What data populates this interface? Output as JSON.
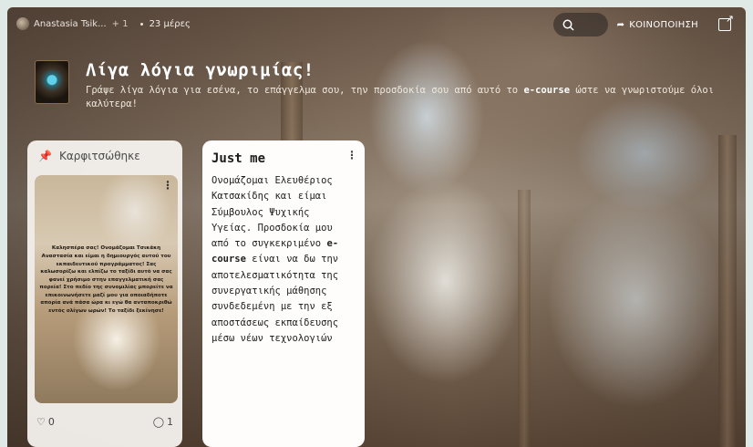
{
  "topbar": {
    "author": "Anastasia Tsik...",
    "extra_authors": "+ 1",
    "age": "23 μέρες",
    "share_label": "ΚΟΙΝΟΠΟΙΗΣΗ"
  },
  "header": {
    "title": "Λίγα λόγια γνωριμίας!",
    "subtitle_prefix": "Γράψε λίγα λόγια για εσένα, το επάγγελμα σου, την προσδοκία σου από αυτό το ",
    "subtitle_bold": "e-course",
    "subtitle_suffix": " ώστε να γνωριστούμε όλοι καλύτερα!"
  },
  "pinned": {
    "heading": "Καρφιτσώθηκε",
    "card_text": "Καλησπέρα σας! Ονομάζομαι Τσικάκη Αναστασία και είμαι η δημιουργός αυτού του εκπαιδευτικού προγράμματος! Σας καλωσορίζω και ελπίζω το ταξίδι αυτό να σας φανεί χρήσιμο στην επαγγελματική σας πορεία! Στο πεδίο της συνομιλίας μπορείτε να επικοινωνήσετε μαζί μου για οποιαδήποτε απορία ανά πάσα ώρα κι εγώ θα ανταποκριθώ εντός ολίγων ωρών! Το ταξίδι ξεκίνησε!",
    "likes": "0",
    "comments": "1"
  },
  "post": {
    "title": "Just me",
    "body_part1": "Ονομάζομαι Ελευθέριος Κατσακίδης και είμαι Σύμβουλος Ψυχικής Υγείας. Προσδοκία μου από το συγκεκριμένο ",
    "body_bold1": "e-course",
    "body_part2": " είναι να δω την αποτελεσματικότητα της συνεργατικής μάθησης συνδεδεμένη με την εξ αποστάσεως εκπαίδευσης μέσω νέων τεχνολογιών"
  },
  "colors": {
    "pinned_bg": "#faf7f4",
    "post_bg": "#fefdfc",
    "topbar_text": "#f1ece6"
  }
}
